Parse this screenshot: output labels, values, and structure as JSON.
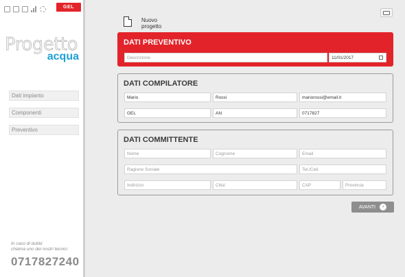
{
  "sidebar": {
    "brand_badge": "GEL",
    "logo_main": "Progetto",
    "logo_sub": "acqua",
    "nav": [
      "Dati impianto",
      "Componenti",
      "Preventivo"
    ],
    "help_line1": "In caso di dubbi",
    "help_line2": "chiama uno dei nostri tecnici",
    "phone": "0717827240"
  },
  "header": {
    "new_project_line1": "Nuovo",
    "new_project_line2": "progetto"
  },
  "preventivo": {
    "title": "DATI PREVENTIVO",
    "descrizione_placeholder": "Descrizione",
    "date": "11/01/2017"
  },
  "compilatore": {
    "title": "DATI COMPILATORE",
    "nome": "Mario",
    "cognome": "Rossi",
    "email": "mariorossi@email.it",
    "ragione": "GEL",
    "provincia": "AN",
    "tel": "0717827"
  },
  "committente": {
    "title": "DATI COMMITTENTE",
    "nome_ph": "Nome",
    "cognome_ph": "Cognome",
    "email_ph": "Email",
    "ragione_ph": "Ragione Sociale",
    "tel_ph": "Tel./Cell.",
    "indirizzo_ph": "Indirizzo",
    "citta_ph": "Citta'",
    "cap_ph": "CAP",
    "provincia_ph": "Provincia"
  },
  "actions": {
    "avanti": "AVANTI",
    "avanti_arrow": "›"
  },
  "colors": {
    "accent_red": "#e3232a",
    "logo_blue": "#1d9fd6"
  }
}
